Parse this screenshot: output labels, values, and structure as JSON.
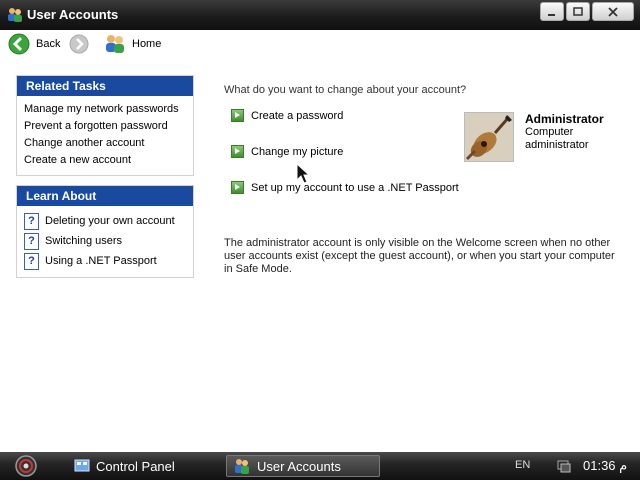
{
  "window": {
    "title": "User Accounts"
  },
  "nav": {
    "back_label": "Back",
    "home_label": "Home"
  },
  "related_tasks": {
    "header": "Related Tasks",
    "items": [
      "Manage my network passwords",
      "Prevent a forgotten password",
      "Change another account",
      "Create a new account"
    ]
  },
  "learn_about": {
    "header": "Learn About",
    "items": [
      "Deleting your own account",
      "Switching users",
      "Using a .NET Passport"
    ]
  },
  "main": {
    "question": "What do you want to change about your account?",
    "actions": [
      "Create a password",
      "Change my picture",
      "Set up my account to use a .NET Passport"
    ],
    "note": "The administrator account is only visible on the Welcome screen when no other user accounts exist (except the guest account), or when you start your computer in Safe Mode."
  },
  "account": {
    "name": "Administrator",
    "type": "Computer administrator",
    "picture_icon": "guitar-picture"
  },
  "taskbar": {
    "items": [
      "Control Panel",
      "User Accounts"
    ],
    "language": "EN",
    "clock": "01:36 م"
  },
  "colors": {
    "titlebar": "#1c1c1c",
    "panel_header": "#1a4aa0",
    "taskbar": "#262626",
    "action_arrow": "#3f8f2f"
  }
}
